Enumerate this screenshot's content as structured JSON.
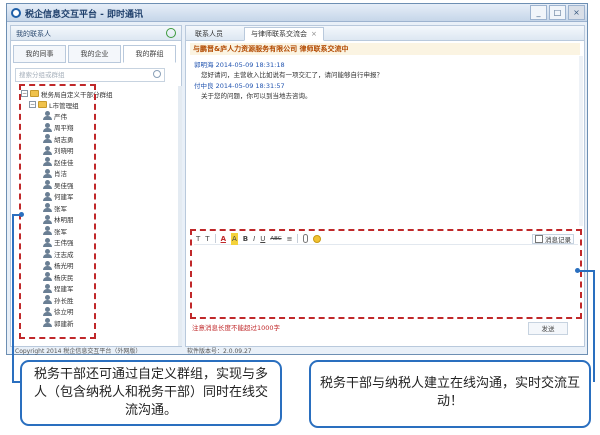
{
  "window": {
    "title": "税企信息交互平台 - 即时通讯",
    "controls": [
      "_",
      "□",
      "×"
    ]
  },
  "left_panel": {
    "header": "我的联系人",
    "tabs": [
      "我的同事",
      "我的企业",
      "我的群组"
    ],
    "search_placeholder": "搜索分组或群组",
    "tree": {
      "root": "税务局自定义干部分群组",
      "group": "L市管理组",
      "members": [
        "严伟",
        "周平翔",
        "胡志勇",
        "刘晓明",
        "赵佳佳",
        "肖洁",
        "吴佳强",
        "何建军",
        "张军",
        "林明朋",
        "张军",
        "王伟强",
        "汪志成",
        "杨光明",
        "杨庆民",
        "程建军",
        "孙长胜",
        "徐立明",
        "郭建新"
      ]
    }
  },
  "chat": {
    "tabs": [
      "联系人员",
      "与律师联系交流会"
    ],
    "heading": "与鹏晋&庐人力资源服务有限公司 律师联系交流中",
    "messages": [
      {
        "sender_time": "郭明海 2014-05-09 18:31:18",
        "text": "您好请问，主营收入比如说有一项交汇了，请问能够自行申报？"
      },
      {
        "sender_time": "付中良 2014-05-09 18:31:57",
        "text": "关于您的问题，你可以到当地去咨询。"
      }
    ],
    "toolbar": {
      "format": "T",
      "size": "T",
      "font_color": "A",
      "highlight": "A",
      "bold": "B",
      "italic": "I",
      "underline": "U",
      "strike": "ABC",
      "align": "≡",
      "history_label": "消息记录"
    },
    "limit_note": "注意消息长度不能超过1000字",
    "send_label": "发送"
  },
  "status": {
    "copyright": "Copyright 2014 税企信息交互平台（外网版）",
    "version": "软件版本号：2.0.09.27"
  },
  "callouts": {
    "left": "税务干部还可通过自定义群组，实现与多人（包含纳税人和税务干部）同时在线交流沟通。",
    "right": "税务干部与纳税人建立在线沟通，实时交流互动！"
  }
}
